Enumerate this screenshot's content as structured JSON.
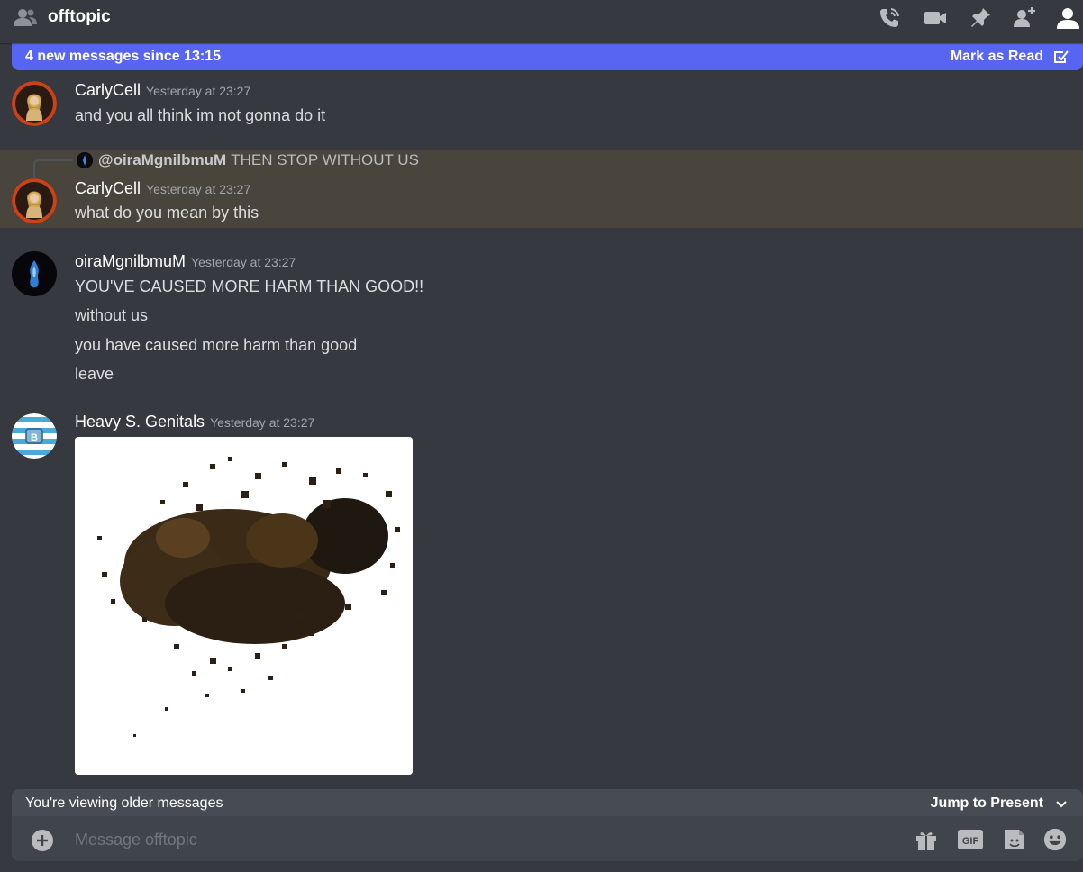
{
  "header": {
    "channel_icon": "users-icon",
    "title": "offtopic",
    "toolbar": [
      "phone-call-icon",
      "video-icon",
      "pin-icon",
      "add-member-icon",
      "member-list-icon"
    ]
  },
  "new_messages_bar": {
    "text": "4 new messages since 13:15",
    "action": "Mark as Read",
    "action_icon": "mark-read-icon"
  },
  "messages": [
    {
      "username": "CarlyCell",
      "timestamp": "Yesterday at 23:27",
      "lines": [
        "and you all think im not gonna do it"
      ]
    },
    {
      "reply": {
        "mention": "@oiraMgnilbmuM",
        "text": "THEN STOP WITHOUT US"
      },
      "username": "CarlyCell",
      "timestamp": "Yesterday at 23:27",
      "lines": [
        "what do you mean by this"
      ]
    },
    {
      "username": "oiraMgnilbmuM",
      "timestamp": "Yesterday at 23:27",
      "lines": [
        "YOU'VE CAUSED MORE HARM THAN GOOD!!",
        "without us",
        "you have caused more harm than good",
        "leave"
      ]
    },
    {
      "username": "Heavy S. Genitals",
      "timestamp": "Yesterday at 23:27",
      "attachment": "image"
    }
  ],
  "older_bar": {
    "text": "You're viewing older messages",
    "action": "Jump to Present"
  },
  "composer": {
    "placeholder": "Message offtopic",
    "buttons": [
      "gift-icon",
      "gif-icon",
      "sticker-icon",
      "emoji-icon"
    ]
  },
  "colors": {
    "background": "#36393f",
    "accent": "#5865f2",
    "highlight": "#49443c",
    "composer": "#40444b"
  }
}
